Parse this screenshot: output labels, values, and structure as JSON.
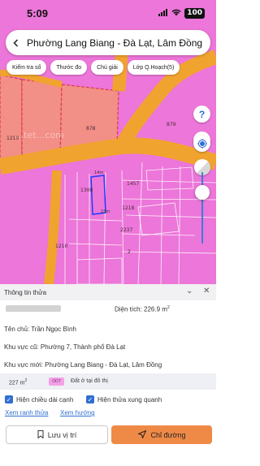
{
  "status_bar": {
    "time": "5:09",
    "battery": "100"
  },
  "header": {
    "title": "Phường Lang Biang - Đà Lạt, Lâm Đồng",
    "back_icon": "back-arrow-icon"
  },
  "chips": [
    "Kiểm tra số",
    "Thước đo",
    "Chú giải",
    "Lớp Q.Hoạch(5)"
  ],
  "map": {
    "controls": [
      "help-icon",
      "compass-icon",
      "locate-icon",
      "opacity-slider"
    ],
    "labels": [
      "878",
      "879",
      "1308",
      "1457",
      "1218",
      "2237",
      "1210",
      "2"
    ],
    "colors": {
      "land_pink": "#ec76d9",
      "road_orange": "#f1a32f",
      "plot_salmon": "#f28f86",
      "plot_border": "#d93b4a"
    },
    "watermark": "...tet...com"
  },
  "sheet": {
    "heading": "Thông tin thửa",
    "area_label": "Diện tích:",
    "area_value": "226.9 m",
    "area_unit_sup": "2",
    "owner": "Tên chủ: Trần Ngọc Bình",
    "old_area": "Khu vực cũ: Phường 7, Thành phố Đà Lạt",
    "new_area": "Khu vực mới: Phường Lang Biang - Đà Lạt, Lâm Đồng",
    "summary_area": "227 m",
    "summary_area_sup": "2",
    "summary_tag": "ODT",
    "summary_label": "Đất ở tại đô thị",
    "checkbox_1": "Hiện chiều dài cạnh",
    "checkbox_2": "Hiện thửa xung quanh",
    "link_1": "Xem ranh thửa",
    "link_2": "Xem hướng",
    "save_button": "Lưu vị trí",
    "route_button": "Chỉ đường"
  }
}
